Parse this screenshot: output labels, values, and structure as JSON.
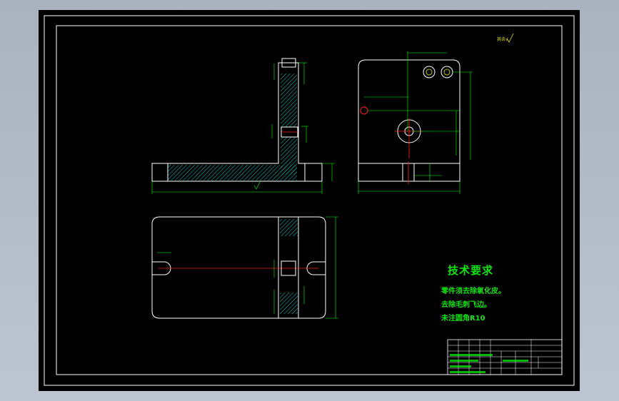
{
  "sheet": {
    "background": "#000000",
    "outer_frame_color": "#ffffff",
    "part_outline_color": "#ffffff",
    "dimension_color": "#00ff00",
    "hatch_color": "#00d8d8",
    "center_line_color": "#ff2020",
    "tech_text_color": "#10e410"
  },
  "technical_requirements": {
    "title": "技术要求",
    "lines": [
      "零件须去除氧化皮。",
      "去除毛刺飞边。",
      "未注圆角R10"
    ]
  },
  "surface_finish_note": "其余√"
}
